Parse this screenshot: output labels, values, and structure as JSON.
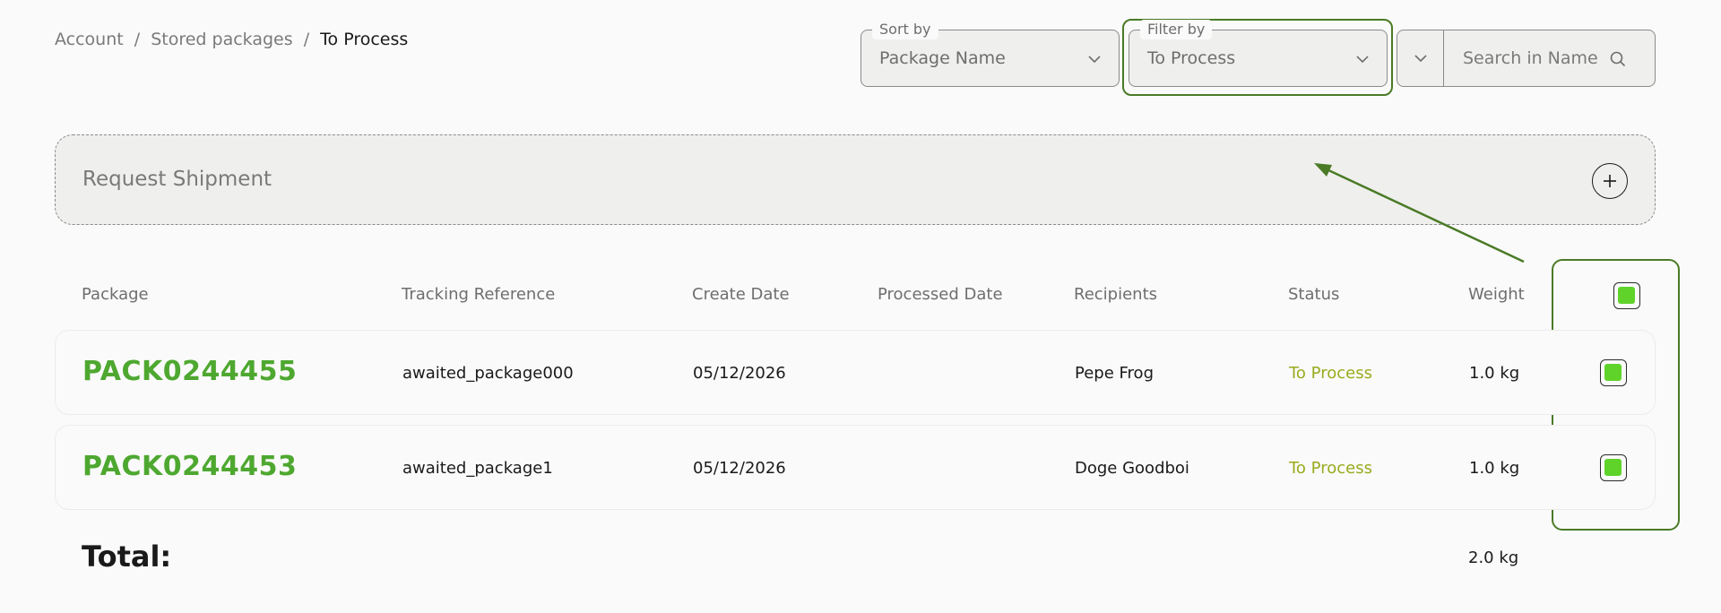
{
  "breadcrumb": {
    "items": [
      "Account",
      "Stored packages"
    ],
    "separator": "/",
    "current": "To Process"
  },
  "sort": {
    "label": "Sort by",
    "value": "Package Name"
  },
  "filter": {
    "label": "Filter by",
    "value": "To Process"
  },
  "search": {
    "placeholder": "Search in Name"
  },
  "request": {
    "label": "Request Shipment"
  },
  "table": {
    "headers": {
      "package": "Package",
      "tracking": "Tracking Reference",
      "create_date": "Create Date",
      "processed_date": "Processed Date",
      "recipients": "Recipients",
      "status": "Status",
      "weight": "Weight"
    },
    "rows": [
      {
        "package": "PACK0244455",
        "tracking": "awaited_package000",
        "create_date": "05/12/2026",
        "processed_date": "",
        "recipients": "Pepe Frog",
        "status": "To Process",
        "weight": "1.0 kg"
      },
      {
        "package": "PACK0244453",
        "tracking": "awaited_package1",
        "create_date": "05/12/2026",
        "processed_date": "",
        "recipients": "Doge Goodboi",
        "status": "To Process",
        "weight": "1.0 kg"
      }
    ]
  },
  "total": {
    "label": "Total:",
    "value": "2.0 kg"
  },
  "colors": {
    "accent_green": "#4ea830",
    "status_yellow_green": "#9aab1e",
    "checkbox_fill": "#5fd32a",
    "highlight_border": "#4a7a26"
  }
}
